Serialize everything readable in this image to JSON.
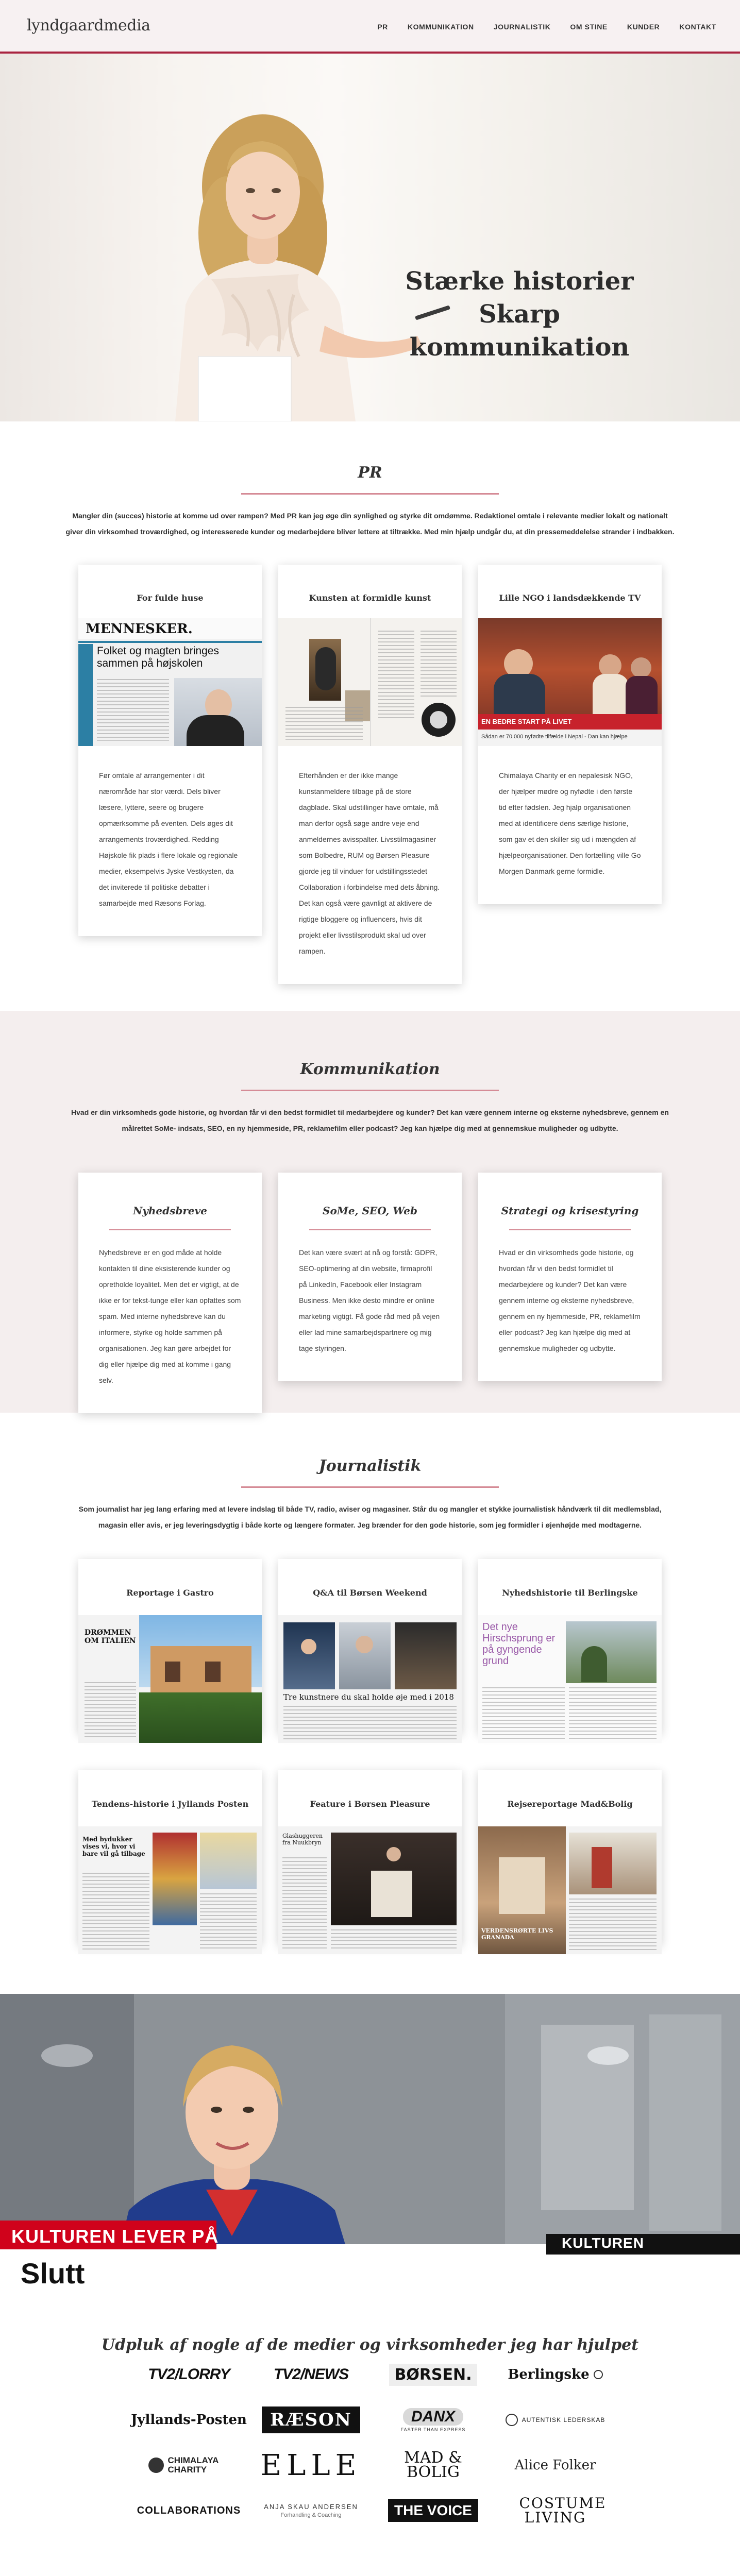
{
  "header": {
    "logo": "lyndgaardmedia",
    "nav": [
      "PR",
      "KOMMUNIKATION",
      "JOURNALISTIK",
      "OM STINE",
      "KUNDER",
      "KONTAKT"
    ]
  },
  "hero": {
    "line1": "Stærke historier",
    "line2": "Skarp kommunikation"
  },
  "pr": {
    "title": "PR",
    "intro": "Mangler din (succes) historie at komme ud over rampen? Med PR kan jeg øge din synlighed og styrke dit omdømme. Redaktionel omtale i relevante medier lokalt og nationalt giver din virksomhed troværdighed, og interesserede kunder og medarbejdere bliver lettere at tiltrække. Med min hjælp undgår du, at din pressemeddelelse strander i indbakken.",
    "cards": [
      {
        "title": "For fulde huse",
        "img_head": "MENNESKER.",
        "img_headline": "Folket og magten bringes sammen på højskolen",
        "text": "Før omtale af arrangementer i dit nærområde har stor værdi. Dels bliver læsere, lyttere, seere og brugere opmærksomme på eventen. Dels øges dit arrangements troværdighed. Redding Højskole fik plads i flere lokale og regionale medier, eksempelvis Jyske Vestkysten, da det inviterede til politiske debatter i samarbejde med Ræsons Forlag."
      },
      {
        "title": "Kunsten at formidle kunst",
        "text": "Efterhånden er der ikke mange kunstanmeldere tilbage på de store dagblade. Skal udstillinger have omtale, må man derfor også søge andre veje end anmeldernes avisspalter. Livsstilmagasiner som Bolbedre, RUM og Børsen Pleasure gjorde jeg til vinduer for udstillingsstedet Collaboration i forbindelse med dets åbning. Det kan også være gavnligt at aktivere de rigtige bloggere og influencers, hvis dit projekt eller livsstilsprodukt skal ud over rampen."
      },
      {
        "title": "Lille NGO i landsdækkende TV",
        "img_caption": "EN BEDRE START PÅ LIVET",
        "img_caption2": "Sådan er 70.000 nyfødte tilfælde i Nepal - Dan kan hjælpe",
        "text": "Chimalaya Charity er en nepalesisk NGO, der hjælper mødre og nyfødte i den første tid efter fødslen. Jeg hjalp organisationen med at identificere dens særlige historie, som gav et den skiller sig ud i mængden af hjælpeorganisationer. Den fortælling ville Go Morgen Danmark gerne formidle."
      }
    ]
  },
  "kommunikation": {
    "title": "Kommunikation",
    "intro": "Hvad er din virksomheds gode historie, og hvordan får vi den bedst formidlet til medarbejdere og kunder? Det kan være gennem interne og eksterne nyhedsbreve, gennem en målrettet SoMe- indsats, SEO, en ny hjemmeside, PR, reklamefilm eller podcast? Jeg kan hjælpe dig med at gennemskue muligheder og udbytte.",
    "cards": [
      {
        "title": "Nyhedsbreve",
        "text": "Nyhedsbreve er en god måde at holde kontakten til dine eksisterende kunder og opretholde loyalitet. Men det er vigtigt, at de ikke er for tekst-tunge eller kan opfattes som spam. Med interne nyhedsbreve kan du informere, styrke og holde sammen på organisationen. Jeg kan gøre arbejdet for dig eller hjælpe dig med at komme i gang selv."
      },
      {
        "title": "SoMe, SEO, Web",
        "text": "Det kan være svært at nå og forstå: GDPR, SEO-optimering af din website, firmaprofil på LinkedIn, Facebook eller Instagram Business. Men ikke desto mindre er online marketing vigtigt. Få gode råd med på vejen eller lad mine samarbejdspartnere og mig tage styringen."
      },
      {
        "title": "Strategi og krisestyring",
        "text": "Hvad er din virksomheds gode historie, og hvordan får vi den bedst formidlet til medarbejdere og kunder? Det kan være gennem interne og eksterne nyhedsbreve, gennem en ny hjemmeside, PR, reklamefilm eller podcast? Jeg kan hjælpe dig med at gennemskue muligheder og udbytte."
      }
    ]
  },
  "journalistik": {
    "title": "Journalistik",
    "intro": "Som journalist har jeg lang erfaring med at levere indslag til både TV, radio, aviser og magasiner. Står du og mangler et stykke journalistisk håndværk til dit medlemsblad, magasin eller avis, er jeg leveringsdygtig i både korte og længere formater. Jeg brænder for den gode historie, som jeg formidler i øjenhøjde med modtagerne.",
    "cards": [
      {
        "title": "Reportage i Gastro",
        "img_text": "DRØMMEN OM ITALIEN"
      },
      {
        "title": "Q&A til Børsen Weekend",
        "img_text": "Tre kunstnere du skal holde øje med i 2018"
      },
      {
        "title": "Nyhedshistorie til Berlingske",
        "img_text": "Det nye Hirschsprung er på gyngende grund"
      },
      {
        "title": "Tendens-historie i Jyllands Posten",
        "img_text": "Med bydukker vises vi, hvor vi bare vil gå tilbage"
      },
      {
        "title": "Feature i Børsen Pleasure",
        "img_text": "Glashuggeren fra Nuukbryn"
      },
      {
        "title": "Rejsereportage Mad&Bolig",
        "img_text": "VERDENSRØRTE LIVS GRANADA"
      }
    ]
  },
  "video": {
    "ticker": "KULTUREN LEVER PÅ",
    "ticker_sub": "Slutt",
    "corner_tag": "KULTUREN"
  },
  "clients": {
    "title": "Udpluk af nogle af de medier og virksomheder jeg har hjulpet",
    "logos": [
      "TV2/LORRY",
      "TV2/NEWS",
      "BØRSEN.",
      "Berlingske",
      "Jyllands-Posten",
      "RÆSON",
      "DANX",
      "AUTENTISK LEDERSKAB",
      "CHIMALAYA CHARITY",
      "ELLE",
      "MAD & BOLIG",
      "Alice Folker",
      "COLLABORATIONS",
      "ANJA SKAU ANDERSEN",
      "THE VOICE",
      "COSTUME LIVING"
    ],
    "logo_subs": {
      "danx": "FASTER THAN EXPRESS",
      "anja": "Forhandling & Coaching"
    }
  },
  "colors": {
    "accent": "#a92440",
    "accent_line": "#d58b96",
    "header_bg": "#f7f1f2",
    "pink_section_bg": "#f4eeee"
  }
}
